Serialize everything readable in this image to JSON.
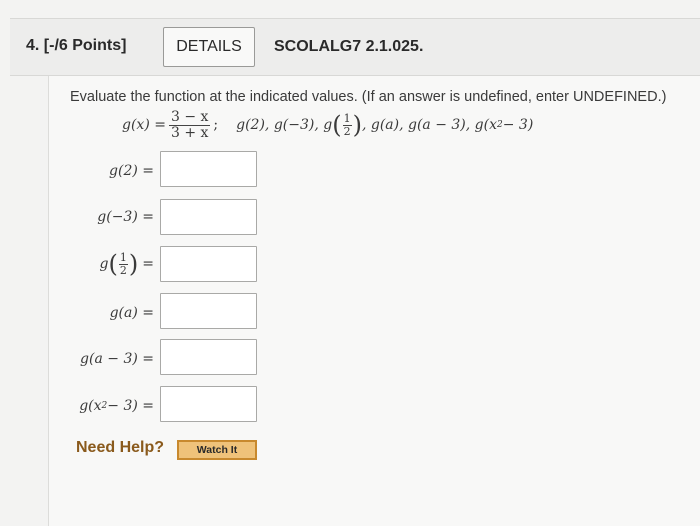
{
  "question": {
    "number_points": "4. [-/6 Points]",
    "details_label": "DETAILS",
    "code": "SCOLALG7 2.1.025."
  },
  "instruction": "Evaluate the function at the indicated values. (If an answer is undefined, enter UNDEFINED.)",
  "function": {
    "lhs": "g(x) =",
    "numerator": "3 − x",
    "denominator": "3 + x",
    "trail": ";"
  },
  "evaluations_list": {
    "item1": "g(2), g(−3), g",
    "half_num": "1",
    "half_den": "2",
    "item2": ", g(a), g(a − 3), g(x",
    "exp": "2",
    "item3": " − 3)"
  },
  "rows": {
    "r1": "g(2) =",
    "r2": "g(−3) =",
    "r3_pre": "g",
    "r3_num": "1",
    "r3_den": "2",
    "r3_post": "=",
    "r4": "g(a) =",
    "r5": "g(a − 3) =",
    "r6_pre": "g(x",
    "r6_exp": "2",
    "r6_post": " − 3) ="
  },
  "answers": [
    "",
    "",
    "",
    "",
    "",
    ""
  ],
  "help": {
    "label": "Need Help?",
    "watch_label": "Watch It"
  },
  "colors": {
    "help_text": "#8a5a1c",
    "watch_bg": "#efc27a",
    "watch_border": "#c8892e"
  }
}
